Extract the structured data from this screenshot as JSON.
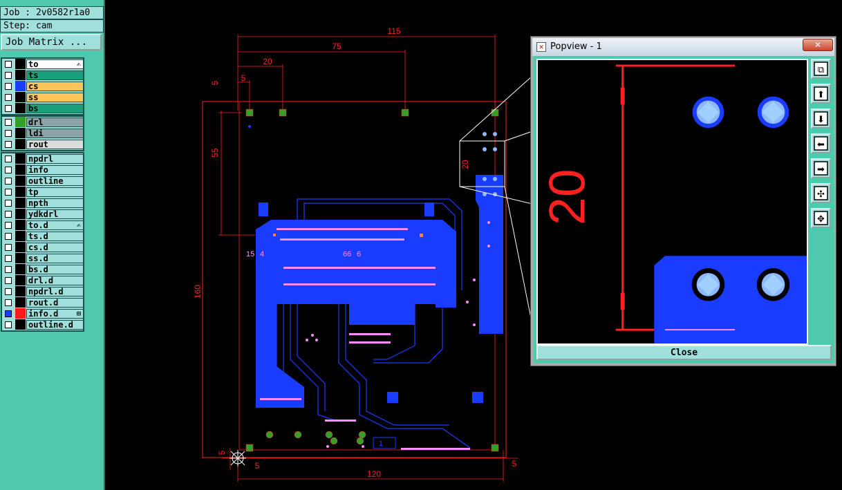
{
  "job": {
    "job_label": "Job : 2v0582r1a0",
    "step_label": "Step: cam",
    "job_matrix_button": "Job Matrix ..."
  },
  "layers": {
    "group_board": [
      {
        "name": "to",
        "color": "#ffffff",
        "swatch": "#000000",
        "flag": "✍"
      },
      {
        "name": "ts",
        "color": "#1aa07a",
        "swatch": "#000000"
      },
      {
        "name": "cs",
        "color": "#ffc55a",
        "swatch": "#1a3cff"
      },
      {
        "name": "ss",
        "color": "#ffc55a",
        "swatch": "#000000"
      },
      {
        "name": "bs",
        "color": "#1aa07a",
        "swatch": "#000000"
      }
    ],
    "group_drill": [
      {
        "name": "drl",
        "color": "#8ca3a8",
        "swatch": "#34a02a"
      },
      {
        "name": "ldi",
        "color": "#8ca3a8",
        "swatch": "#000000"
      },
      {
        "name": "rout",
        "color": "#dcdcdc",
        "swatch": "#000000"
      }
    ],
    "group_misc": [
      {
        "name": "npdrl",
        "color": "#9fe0dc",
        "swatch": "#000000"
      },
      {
        "name": "info",
        "color": "#9fe0dc",
        "swatch": "#000000"
      },
      {
        "name": "outline",
        "color": "#9fe0dc",
        "swatch": "#000000"
      },
      {
        "name": "tp",
        "color": "#9fe0dc",
        "swatch": "#000000"
      },
      {
        "name": "npth",
        "color": "#9fe0dc",
        "swatch": "#000000"
      },
      {
        "name": "ydkdrl",
        "color": "#9fe0dc",
        "swatch": "#000000"
      },
      {
        "name": "to.d",
        "color": "#9fe0dc",
        "swatch": "#000000",
        "flag": "✍"
      },
      {
        "name": "ts.d",
        "color": "#9fe0dc",
        "swatch": "#000000"
      },
      {
        "name": "cs.d",
        "color": "#9fe0dc",
        "swatch": "#000000"
      },
      {
        "name": "ss.d",
        "color": "#9fe0dc",
        "swatch": "#000000"
      },
      {
        "name": "bs.d",
        "color": "#9fe0dc",
        "swatch": "#000000"
      },
      {
        "name": "drl.d",
        "color": "#9fe0dc",
        "swatch": "#000000"
      },
      {
        "name": "npdrl.d",
        "color": "#9fe0dc",
        "swatch": "#000000"
      },
      {
        "name": "rout.d",
        "color": "#9fe0dc",
        "swatch": "#000000"
      },
      {
        "name": "info.d",
        "color": "#9fe0dc",
        "swatch": "#ff1a1a",
        "flag": "⊞",
        "selected": true
      },
      {
        "name": "outline.d",
        "color": "#9fe0dc",
        "swatch": "#000000"
      }
    ]
  },
  "colors": {
    "panel_teal": "#4ec9ad",
    "row_cyan": "#9fe0dc",
    "copper_blue": "#1a3cff",
    "dimension_red": "#ff2020",
    "pad_green": "#34a02a",
    "via_pink": "#ff8cff"
  },
  "dimensions": {
    "board_width": "115",
    "span_75": "75",
    "span_20": "20",
    "span_5_top": "5",
    "offset_5_left": "5",
    "height_55": "55",
    "height_20_small": "20",
    "board_height": "160",
    "overall_width": "120",
    "corner_5_left": "5",
    "corner_5_bottom": "5",
    "corner_5_right": "5",
    "pad_label_15": "15",
    "pad_label_4": "4",
    "pad_label_66": "66",
    "pad_label_6": "6",
    "silkscreen_1": "1"
  },
  "popview": {
    "title": "Popview - 1",
    "close_x": "✕",
    "close_button": "Close",
    "zoom_dimension": "20"
  }
}
